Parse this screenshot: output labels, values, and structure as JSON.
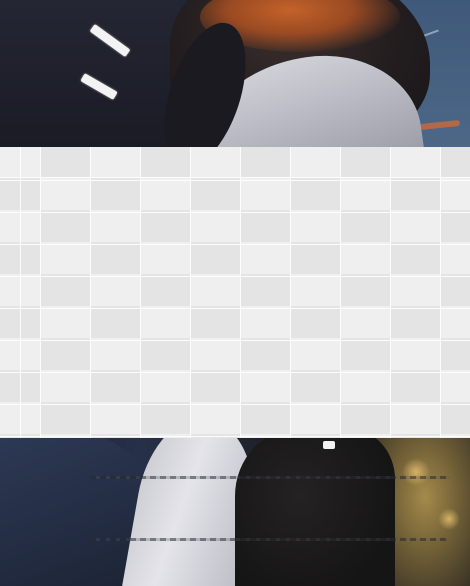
{
  "image": {
    "description_tags": [
      "photo",
      "transparency-checkerboard"
    ],
    "colors": {
      "checker_light": "#efefef",
      "checker_dark": "#e4e4e4",
      "hair_highlight": "#c4622a",
      "background_blue": "#46607e",
      "coat_blue": "#2e3a57",
      "bokeh_gold": "#a48a4a",
      "dash_white": "#f3f3f3"
    }
  }
}
